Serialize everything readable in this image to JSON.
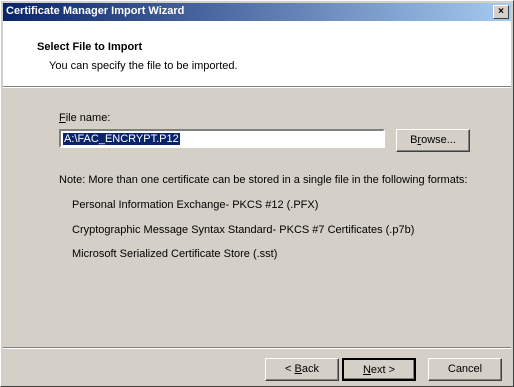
{
  "window": {
    "title": "Certificate Manager Import Wizard",
    "close_label": "×"
  },
  "header": {
    "title": "Select File to Import",
    "subtitle": "You can specify the file to be imported."
  },
  "file": {
    "label_access": "F",
    "label_rest": "ile name:",
    "value": "A:\\FAC_ENCRYPT.P12"
  },
  "browse": {
    "pre": "B",
    "access": "r",
    "post": "owse..."
  },
  "note": "Note:  More than one certificate can be stored in a single file in the following formats:",
  "formats": [
    "Personal Information Exchange- PKCS #12 (.PFX)",
    "Cryptographic Message Syntax Standard- PKCS #7 Certificates (.p7b)",
    "Microsoft Serialized Certificate Store (.sst)"
  ],
  "buttons": {
    "back": {
      "pre": "< ",
      "access": "B",
      "post": "ack"
    },
    "next": {
      "access": "N",
      "post": "ext >"
    },
    "cancel": "Cancel"
  }
}
